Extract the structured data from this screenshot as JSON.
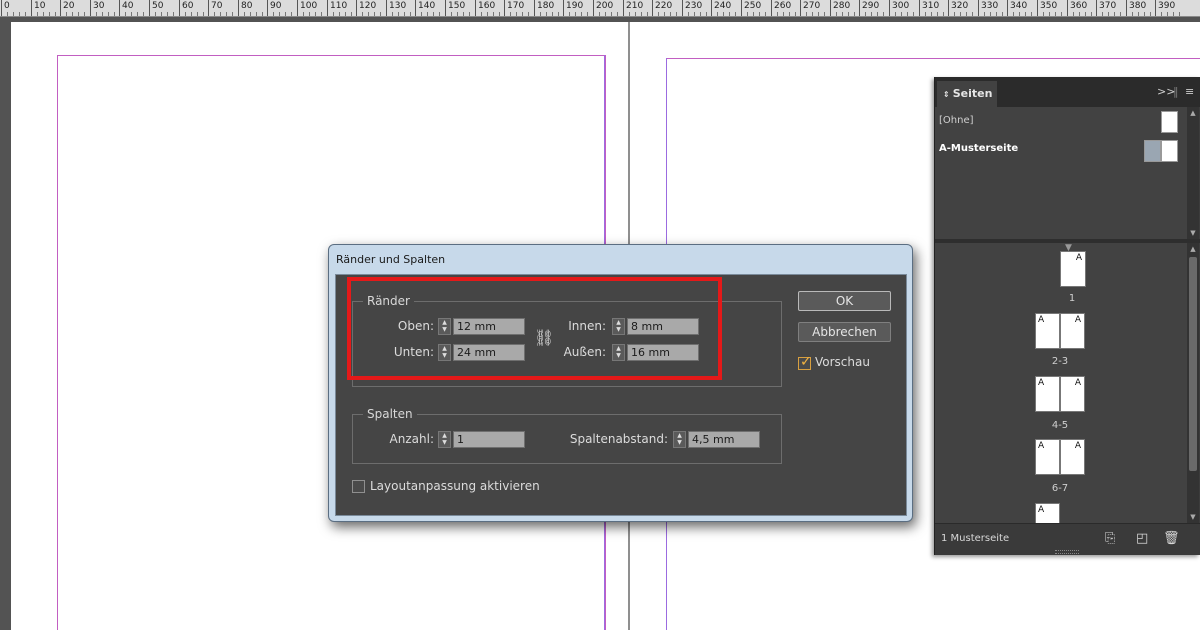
{
  "ruler": {
    "labels": [
      "0",
      "10",
      "20",
      "30",
      "40",
      "50",
      "60",
      "70",
      "80",
      "90",
      "100",
      "110",
      "120",
      "130",
      "140",
      "150",
      "160",
      "170",
      "180",
      "190",
      "200",
      "210",
      "220",
      "230",
      "240",
      "250",
      "260",
      "270",
      "280",
      "290",
      "300",
      "310",
      "320",
      "330",
      "340",
      "350",
      "360",
      "370",
      "380",
      "390"
    ]
  },
  "pages_panel": {
    "tab_label": "Seiten",
    "collapse_label": ">>",
    "masters": [
      {
        "label": "[Ohne]"
      },
      {
        "label": "A-Musterseite"
      }
    ],
    "pages": [
      {
        "label": "1",
        "prefix": "A"
      },
      {
        "label": "2-3",
        "prefix": "A"
      },
      {
        "label": "4-5",
        "prefix": "A"
      },
      {
        "label": "6-7",
        "prefix": "A"
      }
    ],
    "last_page_prefix": "A",
    "footer_count": "1 Musterseite"
  },
  "dialog": {
    "title": "Ränder und Spalten",
    "margins": {
      "group_title": "Ränder",
      "top_label": "Oben:",
      "top_value": "12 mm",
      "bottom_label": "Unten:",
      "bottom_value": "24 mm",
      "inside_label": "Innen:",
      "inside_value": "8 mm",
      "outside_label": "Außen:",
      "outside_value": "16 mm"
    },
    "columns": {
      "group_title": "Spalten",
      "count_label": "Anzahl:",
      "count_value": "1",
      "gutter_label": "Spaltenabstand:",
      "gutter_value": "4,5 mm"
    },
    "layout_adjust_label": "Layoutanpassung aktivieren",
    "layout_adjust_checked": false,
    "ok_label": "OK",
    "cancel_label": "Abbrechen",
    "preview_label": "Vorschau",
    "preview_checked": true
  },
  "colors": {
    "highlight": "#e41919",
    "margin_guide": "#c25ec2",
    "panel_bg": "#424242"
  }
}
